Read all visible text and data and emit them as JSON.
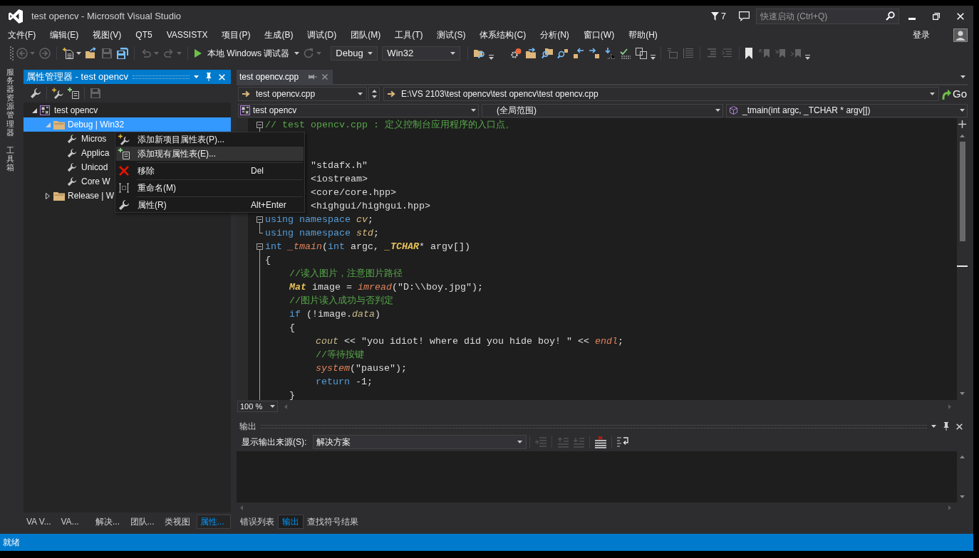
{
  "window": {
    "title": "test opencv - Microsoft Visual Studio",
    "notification_count": "7",
    "quick_launch": {
      "placeholder": "快速启动 (Ctrl+Q)"
    }
  },
  "menu": {
    "items": [
      "文件(F)",
      "编辑(E)",
      "视图(V)",
      "QT5",
      "VASSISTX",
      "项目(P)",
      "生成(B)",
      "调试(D)",
      "团队(M)",
      "工具(T)",
      "测试(S)",
      "体系结构(C)",
      "分析(N)",
      "窗口(W)",
      "帮助(H)"
    ],
    "sign_in": "登录"
  },
  "toolbar": {
    "icons": [
      {
        "disabled": true
      },
      {
        "disabled": true
      },
      {
        "disabled": false
      },
      {
        "disabled": false
      },
      {
        "disabled": true
      },
      {
        "disabled": false
      },
      {
        "disabled": true
      },
      {
        "disabled": true
      },
      {
        "disabled": true
      },
      {
        "disabled": false
      },
      {
        "disabled": false
      },
      {
        "disabled": false
      },
      {
        "disabled": false
      },
      {
        "disabled": false
      },
      {
        "disabled": false
      },
      {
        "disabled": false
      },
      {
        "disabled": false
      },
      {
        "disabled": false
      },
      {
        "disabled": false
      },
      {
        "disabled": true
      },
      {
        "disabled": true
      },
      {
        "disabled": true
      },
      {
        "disabled": true
      },
      {
        "disabled": false
      },
      {
        "disabled": true
      },
      {
        "disabled": true
      },
      {
        "disabled": true
      }
    ],
    "debugger": "本地 Windows 调试器",
    "configuration": "Debug",
    "platform": "Win32"
  },
  "side_tabs": [
    "服务器资源管理器",
    "工具箱"
  ],
  "property_manager": {
    "title": "属性管理器 - test opencv",
    "toolbar": [
      {
        "disabled": false
      },
      {
        "disabled": false
      },
      {
        "disabled": false
      },
      {
        "disabled": true
      }
    ],
    "tree": [
      {
        "label": "test opencv",
        "kind": "project",
        "expanded": true,
        "selected": false,
        "children": [
          {
            "label": "Debug | Win32",
            "kind": "configuration",
            "expanded": true,
            "selected": true,
            "children": [
              {
                "label": "Micros",
                "kind": "property_sheet",
                "selected": false
              },
              {
                "label": "Applica",
                "kind": "property_sheet",
                "selected": false
              },
              {
                "label": "Unicod",
                "kind": "property_sheet",
                "selected": false
              },
              {
                "label": "Core W",
                "kind": "property_sheet",
                "selected": false
              }
            ]
          },
          {
            "label": "Release | W",
            "kind": "configuration",
            "expanded": false,
            "selected": false
          }
        ]
      }
    ],
    "tabs": [
      {
        "label": "VA V...",
        "selected": false
      },
      {
        "label": "VA...",
        "selected": false
      },
      {
        "label": "解决...",
        "selected": false
      },
      {
        "label": "团队...",
        "selected": false
      },
      {
        "label": "类视图",
        "selected": false
      },
      {
        "label": "属性...",
        "selected": true
      }
    ]
  },
  "context_menu": {
    "groups": [
      [
        {
          "label": "添加新项目属性表(P)...",
          "selected": false
        },
        {
          "label": "添加现有属性表(E)...",
          "selected": true
        }
      ],
      [
        {
          "label": "移除",
          "shortcut": "Del",
          "selected": false
        }
      ],
      [
        {
          "label": "重命名(M)",
          "selected": false
        }
      ],
      [
        {
          "label": "属性(R)",
          "shortcut": "Alt+Enter",
          "selected": false
        }
      ]
    ]
  },
  "editor": {
    "tabs": [
      {
        "label": "test opencv.cpp",
        "selected": true
      }
    ],
    "file": "test opencv.cpp",
    "path": "E:\\VS 2103\\test opencv\\test opencv\\test opencv.cpp",
    "go": "Go",
    "project": "test opencv",
    "scope": "(全局范围)",
    "member": "_tmain(int argc, _TCHAR * argv[])",
    "lines": [
      {
        "kind": "start",
        "tokens": [
          {
            "text": "// test opencv.cpp : 定义控制台应用程序的入口点。",
            "kind": "comment"
          }
        ]
      },
      {
        "kind": "blank"
      },
      {
        "kind": "blank"
      },
      {
        "kind": "plain",
        "covered": true,
        "tokens": [
          {
            "text": "\"stdafx.h\"",
            "kind": "plain"
          }
        ]
      },
      {
        "kind": "plain",
        "covered": true,
        "tokens": [
          {
            "text": "<iostream>",
            "kind": "plain"
          }
        ]
      },
      {
        "kind": "plain",
        "covered": true,
        "tokens": [
          {
            "text": "<core/core.hpp>",
            "kind": "plain"
          }
        ]
      },
      {
        "kind": "plain",
        "covered": true,
        "tokens": [
          {
            "text": "<highgui/highgui.hpp>",
            "kind": "plain"
          }
        ]
      },
      {
        "kind": "start",
        "tokens": [
          {
            "text": "using namespace ",
            "kind": "keyword"
          },
          {
            "text": "cv",
            "kind": "namespace"
          },
          {
            "text": ";",
            "kind": "plain"
          }
        ]
      },
      {
        "kind": "end",
        "tokens": [
          {
            "text": "using namespace ",
            "kind": "keyword"
          },
          {
            "text": "std",
            "kind": "namespace"
          },
          {
            "text": ";",
            "kind": "plain"
          }
        ]
      },
      {
        "kind": "start",
        "tokens": [
          {
            "text": "int ",
            "kind": "keyword"
          },
          {
            "text": "_tmain",
            "kind": "function"
          },
          {
            "text": "(",
            "kind": "plain"
          },
          {
            "text": "int ",
            "kind": "keyword"
          },
          {
            "text": "argc, ",
            "kind": "plain"
          },
          {
            "text": "_TCHAR",
            "kind": "type"
          },
          {
            "text": "* argv[])",
            "kind": "plain"
          }
        ]
      },
      {
        "kind": "body",
        "tokens": [
          {
            "text": "{",
            "kind": "plain"
          }
        ],
        "children": [
          {
            "kind": "body",
            "tokens": [
              {
                "text": "//读入图片，注意图片路径",
                "kind": "comment"
              }
            ]
          },
          {
            "kind": "body",
            "tokens": [
              {
                "text": "Mat",
                "kind": "type"
              },
              {
                "text": " image = ",
                "kind": "plain"
              },
              {
                "text": "imread",
                "kind": "function"
              },
              {
                "text": "(\"D:\\\\boy.jpg\");",
                "kind": "plain"
              }
            ]
          },
          {
            "kind": "body",
            "tokens": [
              {
                "text": "//图片读入成功与否判定",
                "kind": "comment"
              }
            ]
          },
          {
            "kind": "body",
            "tokens": [
              {
                "text": "if ",
                "kind": "keyword"
              },
              {
                "text": "(!image.",
                "kind": "plain"
              },
              {
                "text": "data",
                "kind": "member"
              },
              {
                "text": ")",
                "kind": "plain"
              }
            ]
          },
          {
            "kind": "body",
            "tokens": [
              {
                "text": "{",
                "kind": "plain"
              }
            ],
            "children": [
              {
                "kind": "body",
                "tokens": [
                  {
                    "text": "cout",
                    "kind": "member"
                  },
                  {
                    "text": " << \"you idiot! where did you hide boy! \" << ",
                    "kind": "plain"
                  },
                  {
                    "text": "endl",
                    "kind": "function"
                  },
                  {
                    "text": ";",
                    "kind": "plain"
                  }
                ]
              },
              {
                "kind": "body",
                "tokens": [
                  {
                    "text": "//等待按键",
                    "kind": "comment"
                  }
                ]
              },
              {
                "kind": "body",
                "tokens": [
                  {
                    "text": "system",
                    "kind": "function"
                  },
                  {
                    "text": "(\"pause\");",
                    "kind": "plain"
                  }
                ]
              },
              {
                "kind": "body",
                "tokens": [
                  {
                    "text": "return ",
                    "kind": "keyword"
                  },
                  {
                    "text": "-1;",
                    "kind": "plain"
                  }
                ]
              }
            ]
          },
          {
            "kind": "body",
            "tokens": [
              {
                "text": "}",
                "kind": "plain"
              }
            ]
          }
        ]
      }
    ],
    "zoom": "100 %"
  },
  "output": {
    "title": "输出",
    "source_label": "显示输出来源(S):",
    "source": "解决方案",
    "toolbar": [
      {
        "disabled": true
      },
      {
        "disabled": true
      },
      {
        "disabled": true
      },
      {
        "disabled": false
      },
      {
        "disabled": false
      }
    ],
    "tabs": [
      {
        "label": "错误列表",
        "selected": false
      },
      {
        "label": "输出",
        "selected": true
      },
      {
        "label": "查找符号结果",
        "selected": false
      }
    ]
  },
  "status_bar": {
    "text": "就绪"
  }
}
